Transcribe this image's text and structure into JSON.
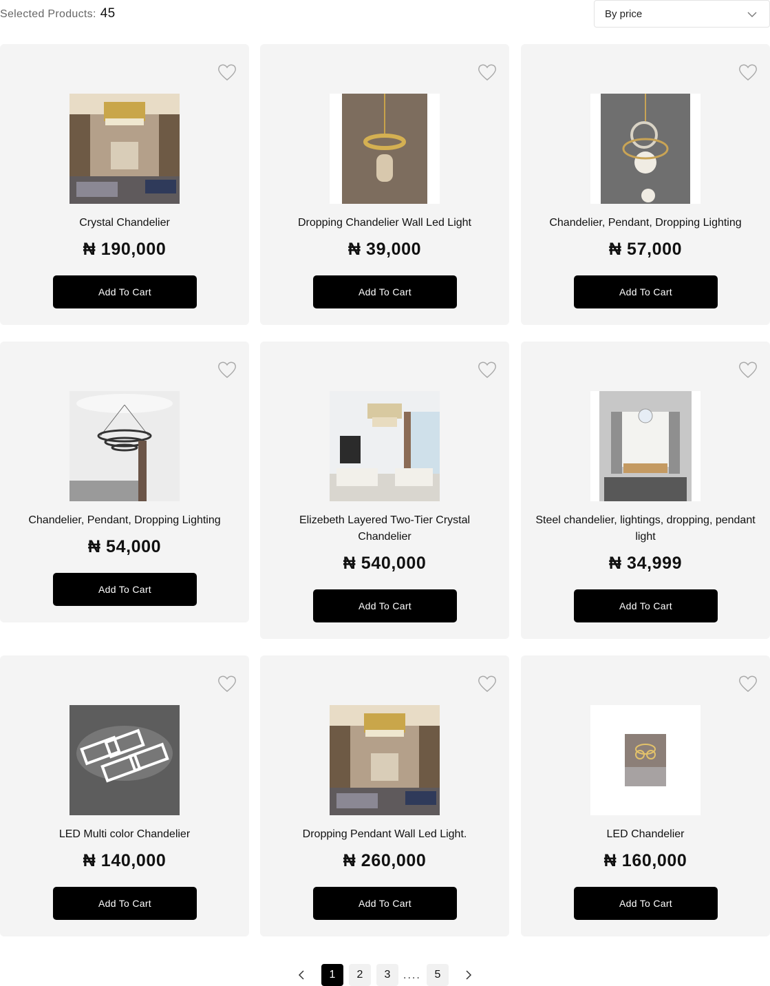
{
  "header": {
    "selected_label": "Selected Products:",
    "selected_count": "45",
    "sort_value": "By price"
  },
  "products": [
    {
      "name": "Crystal Chandelier",
      "price": "₦ 190,000",
      "button": "Add To Cart"
    },
    {
      "name": "Dropping Chandelier Wall Led Light",
      "price": "₦ 39,000",
      "button": "Add To Cart"
    },
    {
      "name": "Chandelier, Pendant, Dropping Lighting",
      "price": "₦ 57,000",
      "button": "Add To Cart"
    },
    {
      "name": "Chandelier, Pendant, Dropping Lighting",
      "price": "₦ 54,000",
      "button": "Add To Cart"
    },
    {
      "name": "Elizebeth Layered Two-Tier Crystal Chandelier",
      "price": "₦ 540,000",
      "button": "Add To Cart"
    },
    {
      "name": "Steel chandelier, lightings, dropping, pendant light",
      "price": "₦ 34,999",
      "button": "Add To Cart"
    },
    {
      "name": "LED Multi color Chandelier",
      "price": "₦ 140,000",
      "button": "Add To Cart"
    },
    {
      "name": "Dropping Pendant Wall Led Light.",
      "price": "₦ 260,000",
      "button": "Add To Cart"
    },
    {
      "name": "LED Chandelier",
      "price": "₦ 160,000",
      "button": "Add To Cart"
    }
  ],
  "pagination": {
    "pages": [
      "1",
      "2",
      "3",
      "5"
    ],
    "active": "1",
    "ellipsis": "....",
    "prev_icon": "chevron-left-icon",
    "next_icon": "chevron-right-icon"
  },
  "colors": {
    "card_bg": "#f4f4f4",
    "button_bg": "#000000",
    "button_text": "#ffffff"
  }
}
